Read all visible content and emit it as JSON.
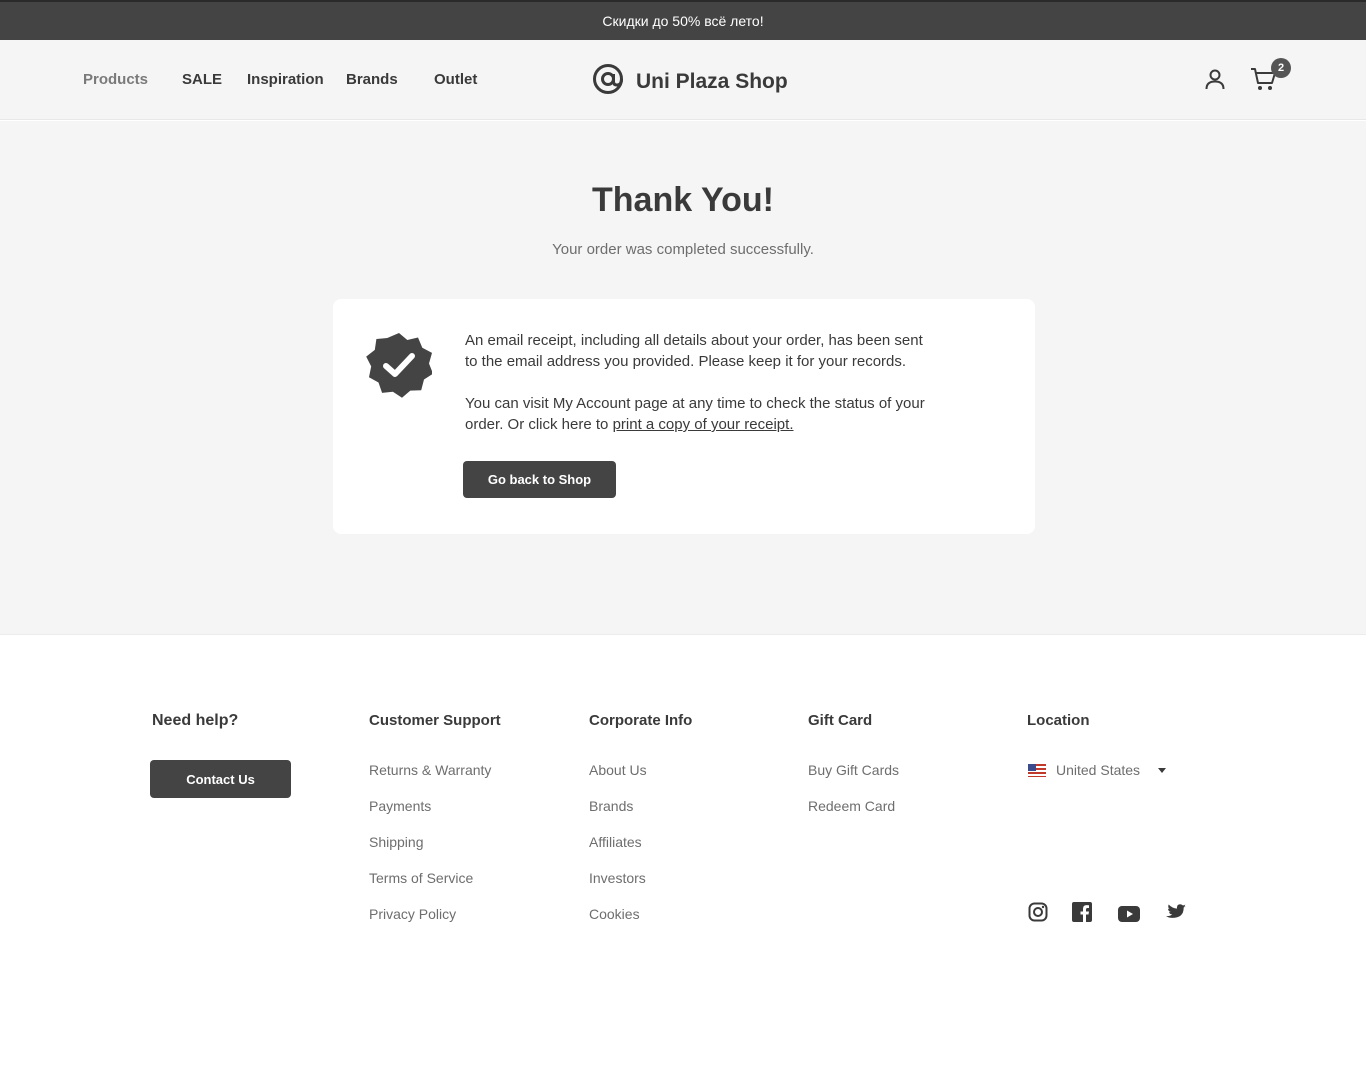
{
  "promo_bar": {
    "text": "Скидки до 50% всё лето!"
  },
  "header": {
    "nav": [
      {
        "label": "Products"
      },
      {
        "label": "SALE"
      },
      {
        "label": "Inspiration"
      },
      {
        "label": "Brands"
      },
      {
        "label": "Outlet"
      }
    ],
    "logo_text": "Uni Plaza Shop",
    "cart_count": "2",
    "icons": [
      "at-sign-logo-icon",
      "user-icon",
      "cart-icon"
    ]
  },
  "confirmation": {
    "title": "Thank You!",
    "subtitle": "Your order was completed successfully.",
    "paragraph1": "An email receipt, including all details about your order, has been sent to the email address you provided. Please keep it for your records.",
    "paragraph2_prefix": "You can visit My Account page at any time to check the status of your order. Or click here to ",
    "paragraph2_link": "print a copy of your receipt.",
    "button_label": "Go back to Shop",
    "icon": "verified-badge-icon"
  },
  "footer": {
    "help": {
      "heading": "Need help?",
      "button_label": "Contact Us"
    },
    "customer_support": {
      "heading": "Customer Support",
      "links": [
        "Returns & Warranty",
        "Payments",
        "Shipping",
        "Terms of Service",
        "Privacy Policy"
      ]
    },
    "corporate_info": {
      "heading": "Corporate Info",
      "links": [
        "About Us",
        "Brands",
        "Affiliates",
        "Investors",
        "Cookies"
      ]
    },
    "gift_card": {
      "heading": "Gift Card",
      "links": [
        "Buy Gift Cards",
        "Redeem Card"
      ]
    },
    "location": {
      "heading": "Location",
      "selected": "United States"
    },
    "social_icons": [
      "instagram-icon",
      "facebook-icon",
      "youtube-icon",
      "twitter-icon"
    ]
  },
  "colors": {
    "dark": "#444444",
    "background": "#f5f5f5",
    "text": "#3a3a3a",
    "muted": "#6e6e6e"
  }
}
